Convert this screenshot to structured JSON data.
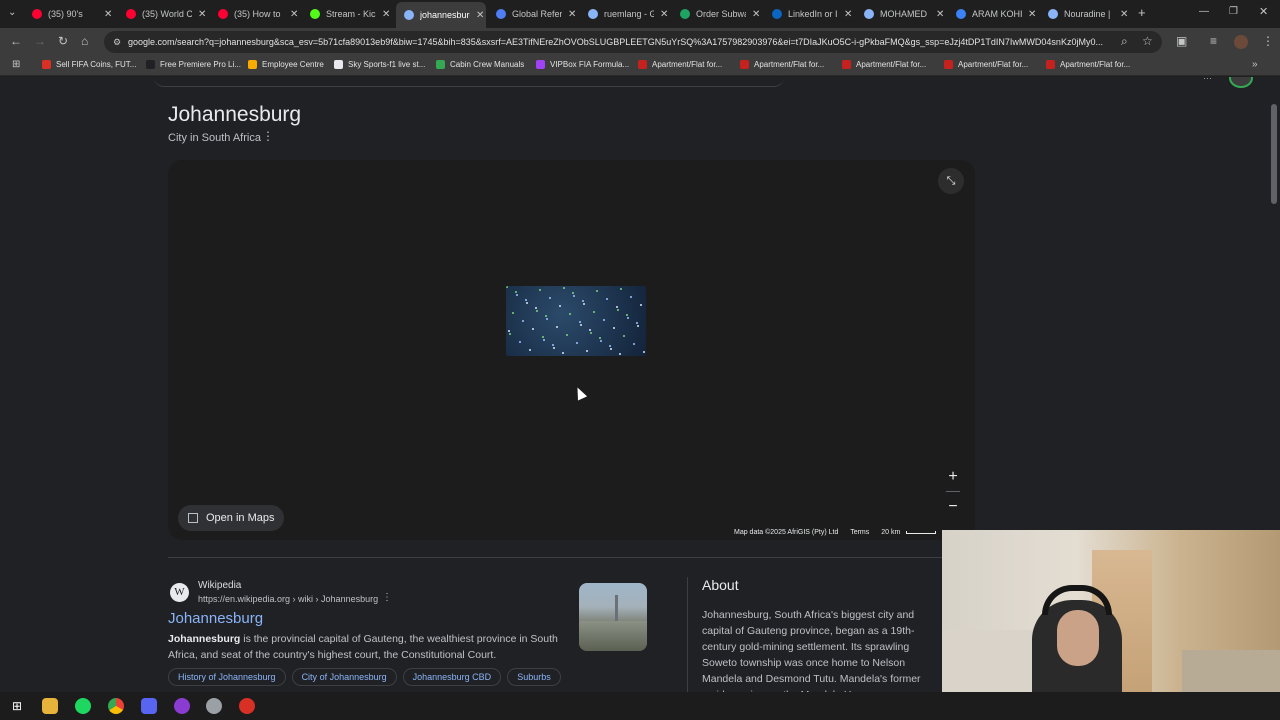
{
  "tabs": [
    {
      "label": "(35) 90's",
      "favicon_color": "#ff0033"
    },
    {
      "label": "(35) World C",
      "favicon_color": "#ff0033"
    },
    {
      "label": "(35) How to",
      "favicon_color": "#ff0033"
    },
    {
      "label": "Stream - Kick",
      "favicon_color": "#53fc18"
    },
    {
      "label": "johannesburg",
      "favicon_color": "#8ab4f8",
      "active": true
    },
    {
      "label": "Global Refer",
      "favicon_color": "#4f7df3"
    },
    {
      "label": "ruemlang - G",
      "favicon_color": "#8ab4f8"
    },
    {
      "label": "Order Subwa",
      "favicon_color": "#1ea362"
    },
    {
      "label": "LinkedIn or I",
      "favicon_color": "#0a66c2"
    },
    {
      "label": "MOHAMED",
      "favicon_color": "#8ab4f8"
    },
    {
      "label": "ARAM KOHI",
      "favicon_color": "#3b82f6"
    },
    {
      "label": "Nouradine |",
      "favicon_color": "#8ab4f8"
    }
  ],
  "address": {
    "url": "google.com/search?q=johannesburg&sca_esv=5b71cfa89013eb9f&biw=1745&bih=835&sxsrf=AE3TifNEreZhOVObSLUGBPLEETGN5uYrSQ%3A1757982903976&ei=t7DIaJKuO5C-i-gPkbaFMQ&gs_ssp=eJzj4tDP1TdIN7IwMWD04snKz0jMy0..."
  },
  "bookmarks": [
    {
      "label": "Sell FIFA Coins, FUT...",
      "color": "#d93025"
    },
    {
      "label": "Free Premiere Pro Li...",
      "color": "#202124"
    },
    {
      "label": "Employee Centre",
      "color": "#f9ab00"
    },
    {
      "label": "Sky Sports-f1 live st...",
      "color": "#e8eaed"
    },
    {
      "label": "Cabin Crew Manuals",
      "color": "#34a853"
    },
    {
      "label": "VIPBox FIA Formula...",
      "color": "#a142f4"
    },
    {
      "label": "Apartment/Flat for...",
      "color": "#c5221f"
    },
    {
      "label": "Apartment/Flat for...",
      "color": "#c5221f"
    },
    {
      "label": "Apartment/Flat for...",
      "color": "#c5221f"
    },
    {
      "label": "Apartment/Flat for...",
      "color": "#c5221f"
    },
    {
      "label": "Apartment/Flat for...",
      "color": "#c5221f"
    }
  ],
  "knowledge": {
    "title": "Johannesburg",
    "subtitle": "City in South Africa"
  },
  "map": {
    "open_in_maps": "Open in Maps",
    "attribution": "Map data ©2025 AfriGIS (Pty) Ltd",
    "terms": "Terms",
    "scale": "20 km"
  },
  "wiki": {
    "site": "Wikipedia",
    "url": "https://en.wikipedia.org › wiki › Johannesburg",
    "title": "Johannesburg",
    "snippet_bold": "Johannesburg",
    "snippet_rest": " is the provincial capital of Gauteng, the wealthiest province in South Africa, and seat of the country's highest court, the Constitutional Court.",
    "chips": [
      "History of Johannesburg",
      "City of Johannesburg",
      "Johannesburg CBD",
      "Suburbs"
    ]
  },
  "about": {
    "title": "About",
    "text": "Johannesburg, South Africa's biggest city and capital of Gauteng province, began as a 19th-century gold-mining settlement. Its sprawling Soweto township was once home to Nelson Mandela and Desmond Tutu. Mandela's former residence is now the Mandela House museum. Other"
  }
}
